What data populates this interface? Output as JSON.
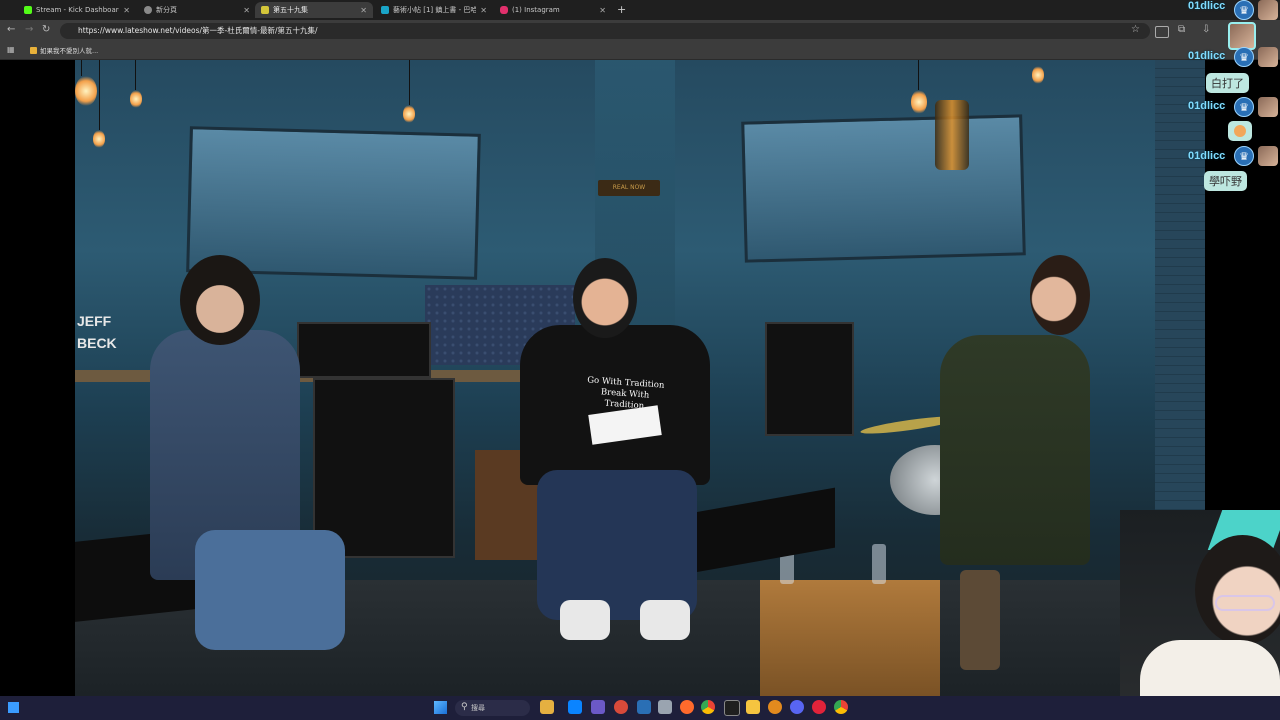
{
  "browser": {
    "tabs": [
      {
        "label": "Stream - Kick Dashboard",
        "icon_color": "#53fc18",
        "active": false
      },
      {
        "label": "新分頁",
        "icon_color": "#8a8a8a",
        "active": false
      },
      {
        "label": "第五十九集",
        "icon_color": "#d4c63a",
        "active": true
      },
      {
        "label": "藝術小帖 [1] 鎮上書 - 巴哈姆特",
        "icon_color": "#1aa5c8",
        "active": false
      },
      {
        "label": "(1) Instagram",
        "icon_color": "#e1306c",
        "active": false
      }
    ],
    "url": "https://www.lateshow.net/videos/第一季-杜氏爾情-最新/第五十九集/",
    "bookmark": "如果我不愛別人就..."
  },
  "video": {
    "sign_text": "REAL NOW",
    "shirt_text": [
      "Go With Tradition",
      "Break With Tradition"
    ],
    "wall_text": [
      "JEFF",
      "BECK"
    ]
  },
  "chat": [
    {
      "type": "name",
      "name": "01dlicc"
    },
    {
      "type": "name",
      "name": "01dlicc"
    },
    {
      "type": "bubble",
      "text": "白打了"
    },
    {
      "type": "name",
      "name": "01dlicc"
    },
    {
      "type": "emote"
    },
    {
      "type": "name",
      "name": "01dlicc"
    },
    {
      "type": "bubble",
      "text": "學吓野"
    }
  ],
  "taskbar": {
    "search_placeholder": "搜尋"
  },
  "colors": {
    "chat_name": "#7fdcff",
    "bubble_bg": "#bde7e0",
    "taskbar": "#1e1f3a"
  }
}
